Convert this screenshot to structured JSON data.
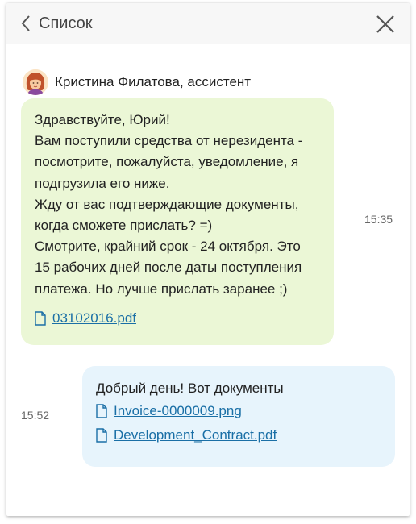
{
  "header": {
    "back_label": "Список"
  },
  "incoming": {
    "sender_name": "Кристина Филатова, ассистент",
    "lines": [
      "Здравствуйте, Юрий!",
      "Вам поступили средства от нерезидента -",
      "посмотрите, пожалуйста, уведомление, я",
      "подгрузила его ниже.",
      "Жду от вас подтверждающие документы,",
      "когда сможете прислать? =)",
      "Смотрите, крайний срок - 24 октября. Это",
      "15 рабочих дней после даты поступления",
      "платежа. Но лучше прислать заранее ;)"
    ],
    "attachments": [
      "03102016.pdf"
    ],
    "time": "15:35"
  },
  "outgoing": {
    "text": "Добрый день! Вот документы",
    "attachments": [
      "Invoice-0000009.png",
      "Development_Contract.pdf"
    ],
    "time": "15:52"
  },
  "colors": {
    "incoming_bubble": "#ebf7d6",
    "outgoing_bubble": "#e7f4fc",
    "link": "#1a6fa6"
  },
  "icons": {
    "back": "chevron-left-icon",
    "close": "close-icon",
    "file": "document-icon"
  }
}
